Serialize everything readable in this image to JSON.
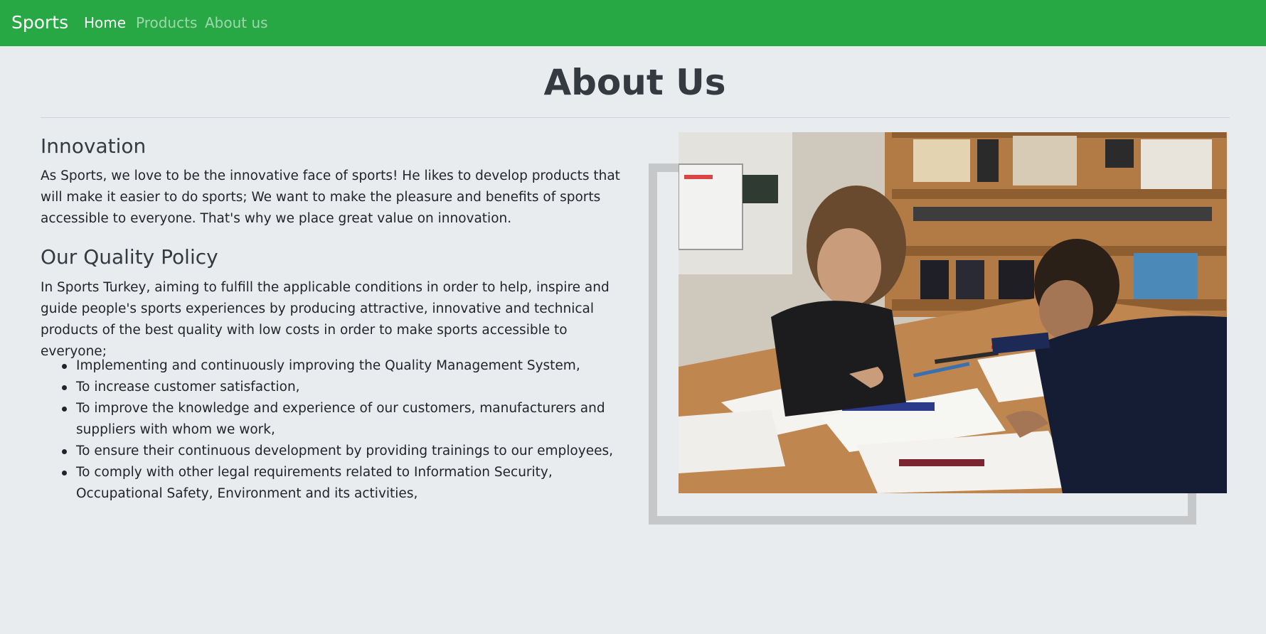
{
  "navbar": {
    "brand": "Sports",
    "links": [
      "Home",
      "Products",
      "About us"
    ],
    "active": "Home",
    "color": "#28a745"
  },
  "page": {
    "title": "About Us"
  },
  "innovation": {
    "title": "Innovation",
    "text": "As Sports, we love to be the innovative face of sports! He likes to develop products that will make it easier to do sports; We want to make the pleasure and benefits of sports accessible to everyone. That's why we place great value on innovation."
  },
  "quality": {
    "title": "Our Quality Policy",
    "text": "In Sports Turkey, aiming to fulfill the applicable conditions in order to help, inspire and guide people's sports experiences by producing attractive, innovative and technical products of the best quality with low costs in order to make sports accessible to everyone;",
    "items": [
      "Implementing and continuously improving the Quality Management System,",
      "To increase customer satisfaction,",
      "To improve the knowledge and experience of our customers, manufacturers and suppliers with whom we work,",
      "To ensure their continuous development by providing trainings to our employees,",
      "To comply with other legal requirements related to Information Security, Occupational Safety, Environment and its activities,"
    ]
  },
  "image": {
    "icon": "team-designing-photo"
  }
}
